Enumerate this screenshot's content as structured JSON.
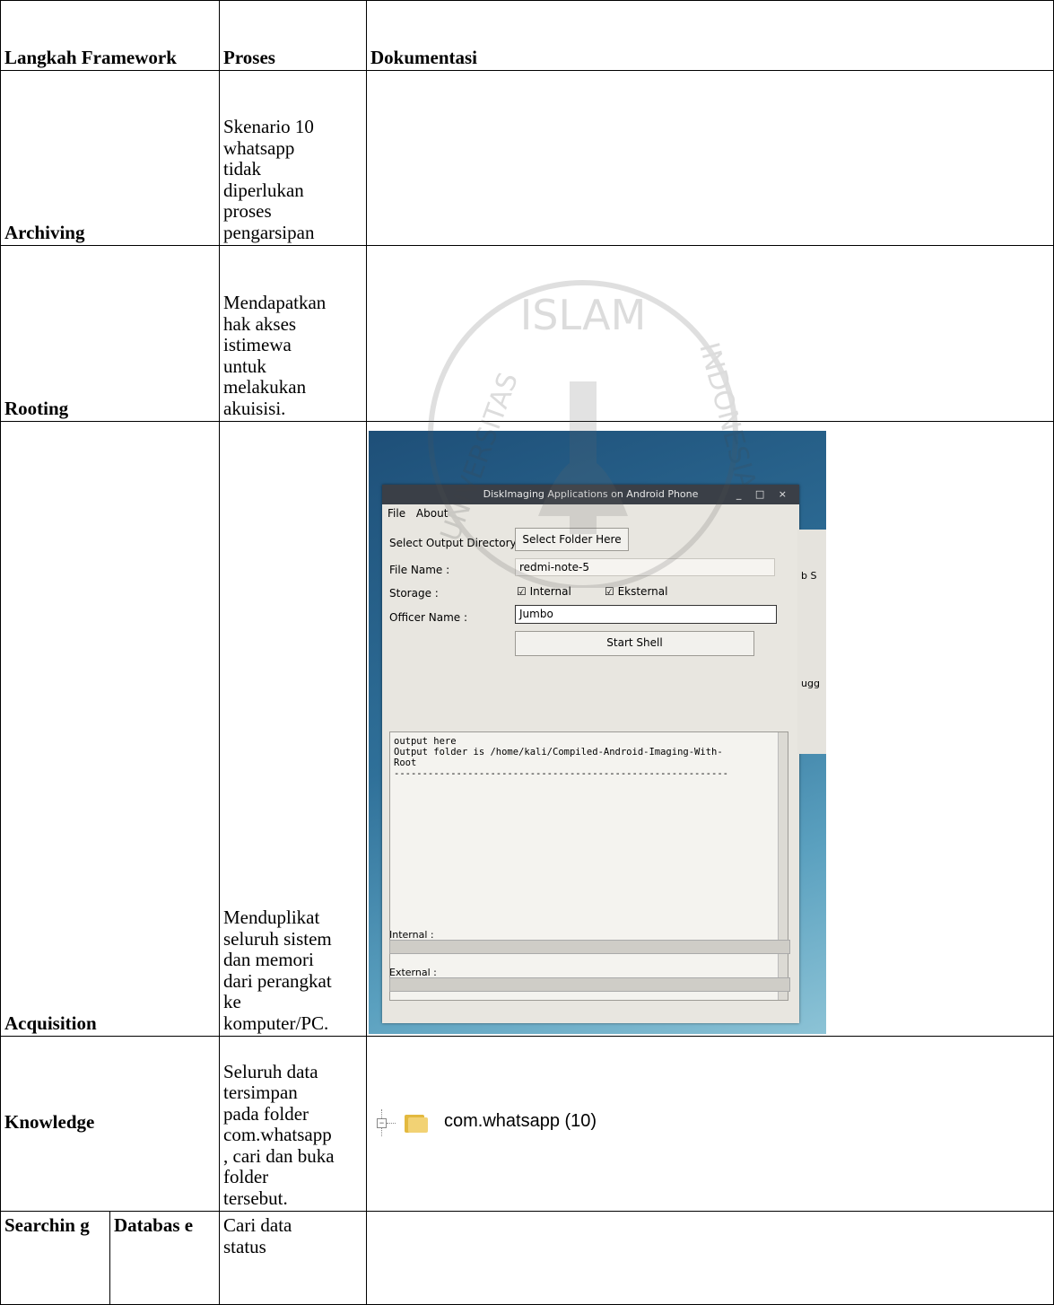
{
  "table": {
    "headers": {
      "langkah": "Langkah Framework",
      "proses": "Proses",
      "dokumentasi": "Dokumentasi"
    },
    "rows": [
      {
        "step": "Archiving",
        "process": "Skenario 10\nwhatsapp\ntidak\ndiperlukan\nproses\npengarsipan"
      },
      {
        "step": "Rooting",
        "process": "Mendapatkan\nhak akses\nistimewa\nuntuk\nmelakukan\nakuisisi."
      },
      {
        "step": "Acquisition",
        "process": "Menduplikat\nseluruh sistem\ndan memori\ndari perangkat\nke\nkomputer/PC."
      },
      {
        "step": "Knowledge",
        "process": "Seluruh data\ntersimpan\npada folder\ncom.whatsapp\n, cari dan buka\nfolder\ntersebut."
      },
      {
        "step": "Searchin\ng",
        "substep": "Databas\ne",
        "process": "Cari data\nstatus"
      }
    ]
  },
  "watermark": {
    "text_top": "ISLAM",
    "text_left": "UNIVERSITAS",
    "text_right": "INDONESIA"
  },
  "screenshot": {
    "window_title": "DiskImaging Applications on Android Phone",
    "window_controls": "_ □ ×",
    "menu": [
      "File",
      "About"
    ],
    "select_output_label": "Select Output Directory",
    "select_folder_button": "Select Folder Here",
    "file_name_label": "File Name :",
    "file_name_value": "redmi-note-5",
    "storage_label": "Storage :",
    "internal_checkbox": "☑ Internal",
    "external_checkbox": "☑ Eksternal",
    "officer_label": "Officer Name :",
    "officer_value": "Jumbo",
    "start_button": "Start Shell",
    "output_text": "output here\nOutput folder is /home/kali/Compiled-Android-Imaging-With-\nRoot\n-----------------------------------------------------------",
    "internal_label": "Internal :",
    "external_label": "External :",
    "side_text_1": "b S",
    "side_text_2": "ugg"
  },
  "knowledge_snippet": {
    "folder_label": "com.whatsapp (10)"
  }
}
